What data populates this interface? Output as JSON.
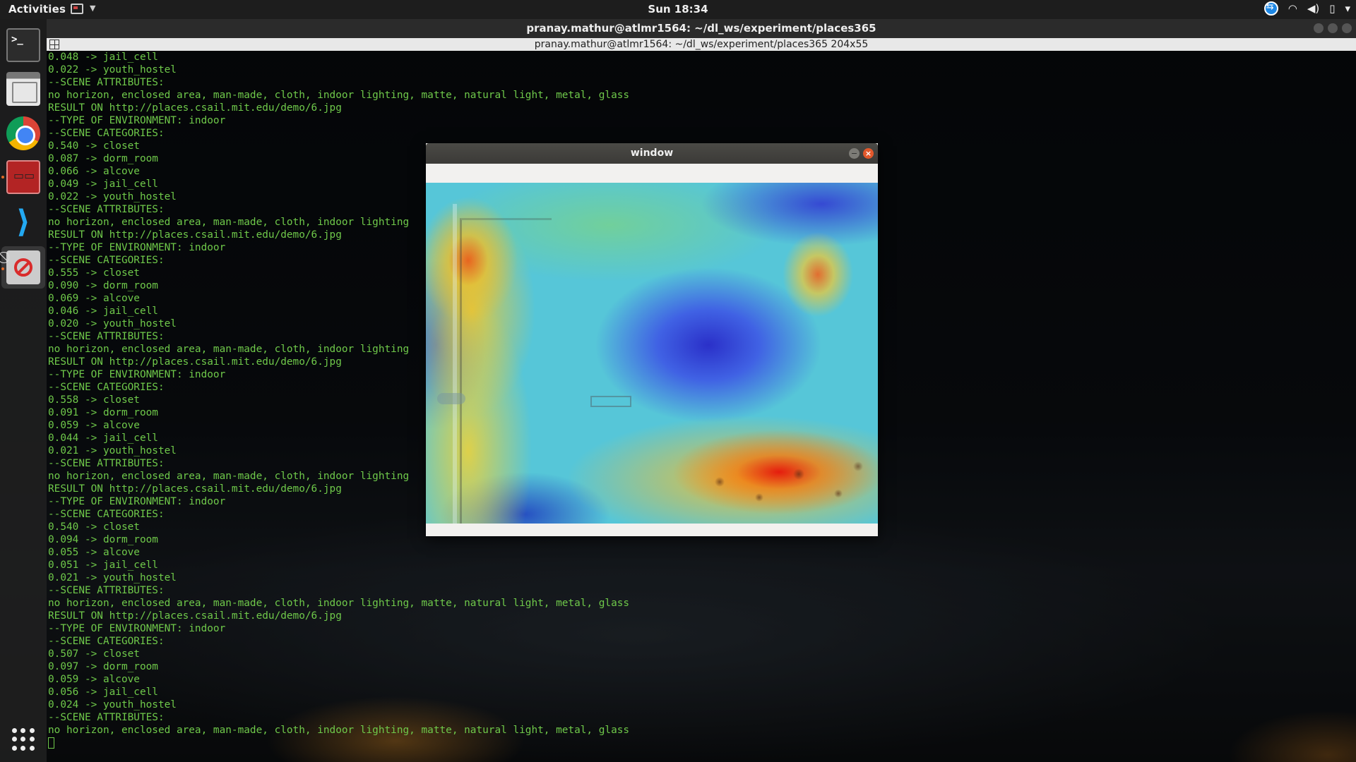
{
  "topbar": {
    "activities": "Activities",
    "clock": "Sun 18:34",
    "tray_icons": [
      "teamviewer-icon",
      "wifi-icon",
      "volume-icon",
      "battery-icon",
      "system-menu-icon"
    ]
  },
  "dock": {
    "items": [
      "terminal",
      "files",
      "google-chrome",
      "matlab",
      "visual-studio-code",
      "no-entry-app"
    ],
    "show_apps_label": "Show Applications"
  },
  "terminal": {
    "title": "pranay.mathur@atlmr1564: ~/dl_ws/experiment/places365",
    "tab_title": "pranay.mathur@atlmr1564: ~/dl_ws/experiment/places365 204x55",
    "lines": [
      "0.048 -> jail_cell",
      "0.022 -> youth_hostel",
      "--SCENE ATTRIBUTES:",
      "no horizon, enclosed area, man-made, cloth, indoor lighting, matte, natural light, metal, glass",
      "RESULT ON http://places.csail.mit.edu/demo/6.jpg",
      "--TYPE OF ENVIRONMENT: indoor",
      "--SCENE CATEGORIES:",
      "0.540 -> closet",
      "0.087 -> dorm_room",
      "0.066 -> alcove",
      "0.049 -> jail_cell",
      "0.022 -> youth_hostel",
      "--SCENE ATTRIBUTES:",
      "no horizon, enclosed area, man-made, cloth, indoor lighting",
      "RESULT ON http://places.csail.mit.edu/demo/6.jpg",
      "--TYPE OF ENVIRONMENT: indoor",
      "--SCENE CATEGORIES:",
      "0.555 -> closet",
      "0.090 -> dorm_room",
      "0.069 -> alcove",
      "0.046 -> jail_cell",
      "0.020 -> youth_hostel",
      "--SCENE ATTRIBUTES:",
      "no horizon, enclosed area, man-made, cloth, indoor lighting",
      "RESULT ON http://places.csail.mit.edu/demo/6.jpg",
      "--TYPE OF ENVIRONMENT: indoor",
      "--SCENE CATEGORIES:",
      "0.558 -> closet",
      "0.091 -> dorm_room",
      "0.059 -> alcove",
      "0.044 -> jail_cell",
      "0.021 -> youth_hostel",
      "--SCENE ATTRIBUTES:",
      "no horizon, enclosed area, man-made, cloth, indoor lighting",
      "RESULT ON http://places.csail.mit.edu/demo/6.jpg",
      "--TYPE OF ENVIRONMENT: indoor",
      "--SCENE CATEGORIES:",
      "0.540 -> closet",
      "0.094 -> dorm_room",
      "0.055 -> alcove",
      "0.051 -> jail_cell",
      "0.021 -> youth_hostel",
      "--SCENE ATTRIBUTES:",
      "no horizon, enclosed area, man-made, cloth, indoor lighting, matte, natural light, metal, glass",
      "RESULT ON http://places.csail.mit.edu/demo/6.jpg",
      "--TYPE OF ENVIRONMENT: indoor",
      "--SCENE CATEGORIES:",
      "0.507 -> closet",
      "0.097 -> dorm_room",
      "0.059 -> alcove",
      "0.056 -> jail_cell",
      "0.024 -> youth_hostel",
      "--SCENE ATTRIBUTES:",
      "no horizon, enclosed area, man-made, cloth, indoor lighting, matte, natural light, metal, glass"
    ],
    "text_color": "#6fc94a"
  },
  "cv_window": {
    "title": "window",
    "content": "class-activation-heatmap"
  }
}
